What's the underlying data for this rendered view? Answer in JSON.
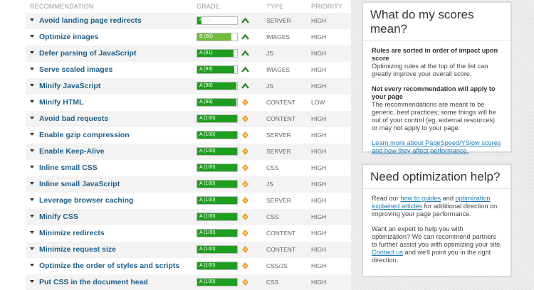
{
  "table": {
    "headers": {
      "recommendation": "RECOMMENDATION",
      "grade": "GRADE",
      "type": "TYPE",
      "priority": "PRIORITY"
    },
    "rows": [
      {
        "name": "Avoid landing page redirects",
        "grade": "F (10)",
        "score": 0.1,
        "trend": "up",
        "type": "SERVER",
        "priority": "HIGH"
      },
      {
        "name": "Optimize images",
        "grade": "B (86)",
        "score": 0.86,
        "trend": "up",
        "type": "IMAGES",
        "priority": "HIGH"
      },
      {
        "name": "Defer parsing of JavaScript",
        "grade": "A (91)",
        "score": 0.91,
        "trend": "up",
        "type": "JS",
        "priority": "HIGH"
      },
      {
        "name": "Serve scaled images",
        "grade": "A (93)",
        "score": 0.93,
        "trend": "up",
        "type": "IMAGES",
        "priority": "HIGH"
      },
      {
        "name": "Minify JavaScript",
        "grade": "A (98)",
        "score": 0.98,
        "trend": "up",
        "type": "JS",
        "priority": "HIGH"
      },
      {
        "name": "Minify HTML",
        "grade": "A (98)",
        "score": 0.98,
        "trend": "neutral",
        "type": "CONTENT",
        "priority": "LOW"
      },
      {
        "name": "Avoid bad requests",
        "grade": "A (100)",
        "score": 1.0,
        "trend": "neutral",
        "type": "CONTENT",
        "priority": "HIGH"
      },
      {
        "name": "Enable gzip compression",
        "grade": "A (100)",
        "score": 1.0,
        "trend": "neutral",
        "type": "SERVER",
        "priority": "HIGH"
      },
      {
        "name": "Enable Keep-Alive",
        "grade": "A (100)",
        "score": 1.0,
        "trend": "neutral",
        "type": "SERVER",
        "priority": "HIGH"
      },
      {
        "name": "Inline small CSS",
        "grade": "A (100)",
        "score": 1.0,
        "trend": "neutral",
        "type": "CSS",
        "priority": "HIGH"
      },
      {
        "name": "Inline small JavaScript",
        "grade": "A (100)",
        "score": 1.0,
        "trend": "neutral",
        "type": "JS",
        "priority": "HIGH"
      },
      {
        "name": "Leverage browser caching",
        "grade": "A (100)",
        "score": 1.0,
        "trend": "neutral",
        "type": "SERVER",
        "priority": "HIGH"
      },
      {
        "name": "Minify CSS",
        "grade": "A (100)",
        "score": 1.0,
        "trend": "neutral",
        "type": "CSS",
        "priority": "HIGH"
      },
      {
        "name": "Minimize redirects",
        "grade": "A (100)",
        "score": 1.0,
        "trend": "neutral",
        "type": "CONTENT",
        "priority": "HIGH"
      },
      {
        "name": "Minimize request size",
        "grade": "A (100)",
        "score": 1.0,
        "trend": "neutral",
        "type": "CONTENT",
        "priority": "HIGH"
      },
      {
        "name": "Optimize the order of styles and scripts",
        "grade": "A (100)",
        "score": 1.0,
        "trend": "neutral",
        "type": "CSS/JS",
        "priority": "HIGH"
      },
      {
        "name": "Put CSS in the document head",
        "grade": "A (100)",
        "score": 1.0,
        "trend": "neutral",
        "type": "CSS",
        "priority": "HIGH"
      }
    ]
  },
  "scores_panel": {
    "title": "What do my scores mean?",
    "p1_heading": "Rules are sorted in order of impact upon score",
    "p1_text": "Optimizing rules at the top of the list can greatly improve your overall score.",
    "p2_heading": "Not every recommendation will apply to your page",
    "p2_text": "The recommendations are meant to be generic, best practices; some things will be out of your control (eg. external resources) or may not apply to your page.",
    "link": "Learn more about PageSpeed/YSlow scores and how they affect performance."
  },
  "help_panel": {
    "title": "Need optimization help?",
    "p1_a": "Read our ",
    "p1_link1": "how to guides",
    "p1_b": " and ",
    "p1_link2": "optimization explained articles",
    "p1_c": " for additional direction on improving your page performance.",
    "p2_a": "Want an expert to help you with optimization? We can recommend partners to further assist you with optimizing your site. ",
    "p2_link": "Contact us",
    "p2_b": " and we'll point you in the right direction."
  },
  "colors": {
    "grade_a": "#1e9e1e",
    "grade_b": "#6fbb3c",
    "grade_f": "#1e9e1e",
    "trend_up": "#2c8a2c",
    "trend_neutral": "#f0a030",
    "link": "#1f7bb5",
    "row_title": "#1f5e8a"
  },
  "icons": {
    "trend_up": "chevron-up-icon",
    "trend_neutral": "diamond-icon",
    "expand": "caret-down-icon"
  }
}
